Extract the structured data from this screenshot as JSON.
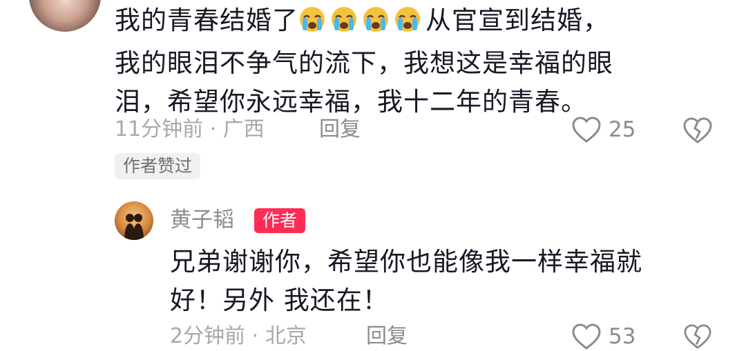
{
  "comment": {
    "line1_prefix": "我的青春结婚了",
    "emojis": [
      "crying-face-emoji",
      "crying-face-emoji",
      "crying-face-emoji",
      "crying-face-emoji"
    ],
    "line1_suffix": "从官宣到结婚，",
    "line2": "我的眼泪不争气的流下，我想这是幸福的眼",
    "line3": "泪，希望你永远幸福，我十二年的青春。",
    "time_location": "11分钟前 · 广西",
    "reply_label": "回复",
    "likes": "25",
    "author_liked_badge": "作者赞过"
  },
  "reply": {
    "username": "黄子韬",
    "author_badge": "作者",
    "line1": "兄弟谢谢你，希望你也能像我一样幸福就",
    "line2": "好！另外 我还在！",
    "time_location": "2分钟前 · 北京",
    "reply_label": "回复",
    "likes": "53"
  },
  "colors": {
    "text": "#161823",
    "meta": "#a7a8ad",
    "author_badge_bg": "#fe2c55",
    "liked_badge_bg": "#f1f1f2"
  },
  "icons": {
    "like": "heart-outline-icon",
    "dislike": "broken-heart-icon"
  }
}
